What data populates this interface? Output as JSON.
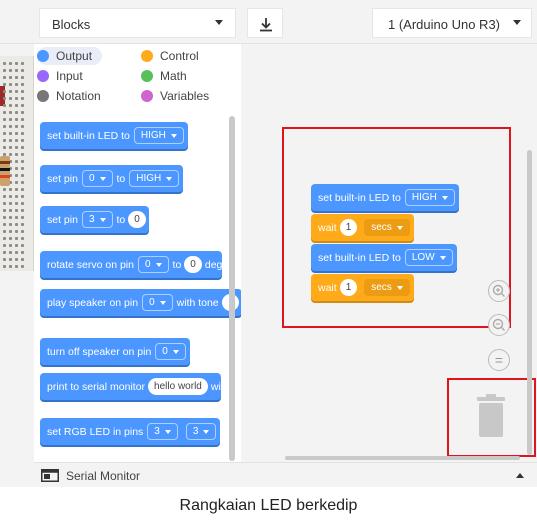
{
  "header": {
    "blocks_label": "Blocks",
    "board_label": "1 (Arduino Uno R3)"
  },
  "categories": [
    {
      "label": "Output",
      "color": "#4c97ff"
    },
    {
      "label": "Control",
      "color": "#ffab19"
    },
    {
      "label": "Input",
      "color": "#9966ff"
    },
    {
      "label": "Math",
      "color": "#59c059"
    },
    {
      "label": "Notation",
      "color": "#777777"
    },
    {
      "label": "Variables",
      "color": "#cf63cf"
    }
  ],
  "palette": {
    "b1": {
      "text": "set built-in LED to",
      "value": "HIGH"
    },
    "b2": {
      "text1": "set pin",
      "value1": "0",
      "text2": "to",
      "value2": "HIGH"
    },
    "b3": {
      "text1": "set pin",
      "value1": "3",
      "text2": "to",
      "value2": "0"
    },
    "b4": {
      "text1": "rotate servo on pin",
      "value1": "0",
      "text2": "to",
      "value2": "0",
      "text3": "deg"
    },
    "b5": {
      "text1": "play speaker on pin",
      "value1": "0",
      "text2": "with tone"
    },
    "b6": {
      "text1": "turn off speaker on pin",
      "value1": "0"
    },
    "b7": {
      "text1": "print to serial monitor",
      "value1": "hello world",
      "text2": "wi"
    },
    "b8": {
      "text1": "set RGB LED in pins",
      "value1": "3",
      "value2": "3"
    }
  },
  "script": {
    "s1": {
      "text": "set built-in LED to",
      "value": "HIGH"
    },
    "s2": {
      "text": "wait",
      "value": "1",
      "unit": "secs"
    },
    "s3": {
      "text": "set built-in LED to",
      "value": "LOW"
    },
    "s4": {
      "text": "wait",
      "value": "1",
      "unit": "secs"
    }
  },
  "zoom": {
    "reset_symbol": "="
  },
  "footer": {
    "serial_monitor_label": "Serial Monitor"
  },
  "caption": "Rangkaian LED berkedip",
  "colors": {
    "output_block": "#4c97ff",
    "control_block": "#ffab19",
    "highlight": "#e0141e"
  }
}
